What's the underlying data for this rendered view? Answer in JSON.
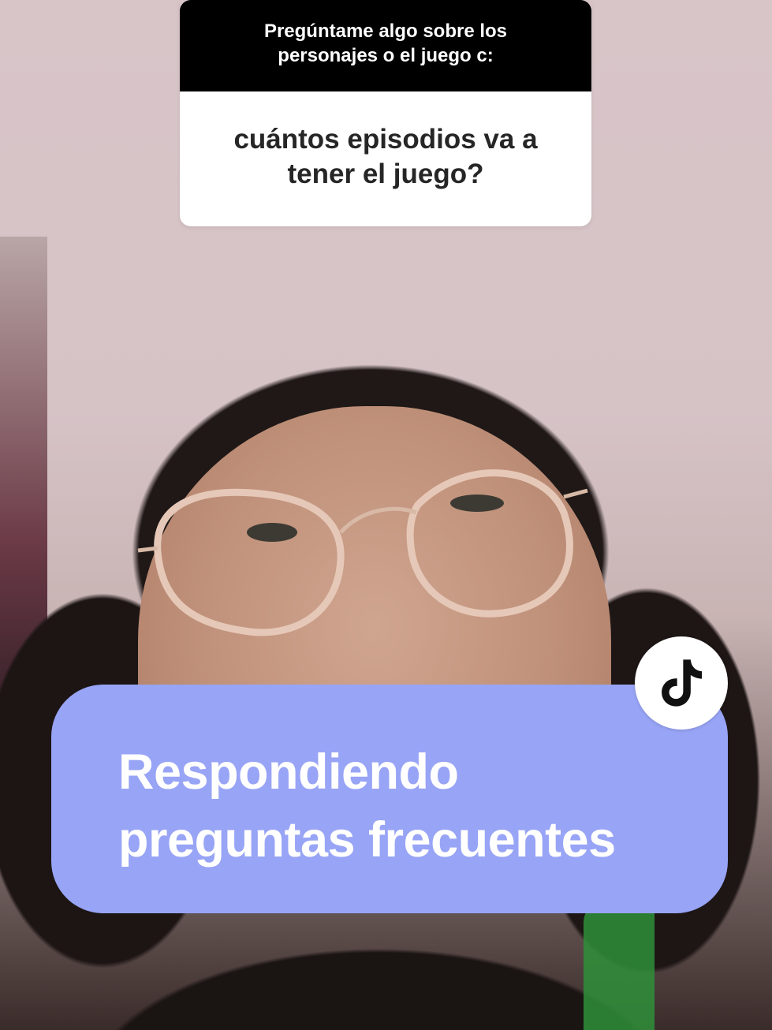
{
  "question_sticker": {
    "prompt": "Pregúntame algo sobre los personajes o el juego c:",
    "question": "cuántos episodios va a tener el juego?"
  },
  "caption": {
    "line1": "Respondiendo",
    "line2": "preguntas frecuentes"
  },
  "badge": {
    "icon": "tiktok-icon"
  },
  "colors": {
    "caption_bg": "#98a4f5",
    "sticker_header_bg": "#000000",
    "sticker_body_bg": "#ffffff"
  }
}
